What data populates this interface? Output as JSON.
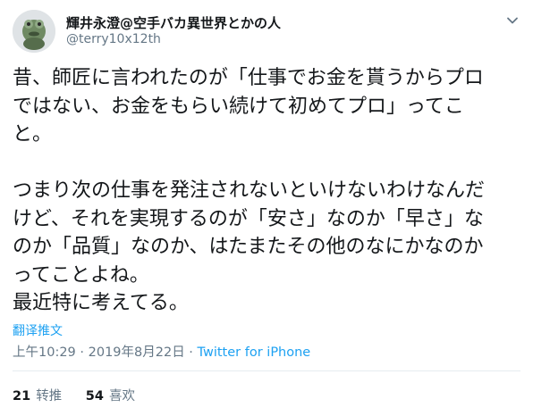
{
  "user": {
    "display_name": "輝井永澄@空手バカ異世界とかの人",
    "handle": "@terry10x12th",
    "avatar_icon": "avatar-frog-figure"
  },
  "tweet": {
    "text": "昔、師匠に言われたのが「仕事でお金を貰うからプロ\nではない、お金をもらい続けて初めてプロ」ってこ\nと。\n\nつまり次の仕事を発注されないといけないわけなんだ\nけど、それを実現するのが「安さ」なのか「早さ」な\nのか「品質」なのか、はたまたその他のなにかなのか\nってことよね。\n最近特に考えてる。",
    "translate_label": "翻译推文",
    "time": "上午10:29 · 2019年8月22日 · ",
    "source": "Twitter for iPhone"
  },
  "stats": {
    "retweets_count": "21",
    "retweets_label": "转推",
    "likes_count": "54",
    "likes_label": "喜欢"
  },
  "colors": {
    "accent": "#1da1f2",
    "text": "#14171a",
    "muted": "#657786"
  }
}
